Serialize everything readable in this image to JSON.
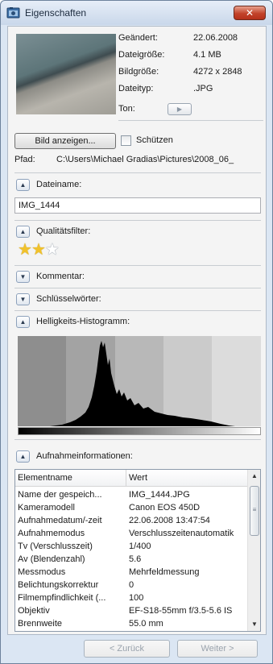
{
  "window": {
    "title": "Eigenschaften",
    "close_label": "✕"
  },
  "file_info": {
    "rows": [
      {
        "label": "Geändert:",
        "value": "22.06.2008"
      },
      {
        "label": "Dateigröße:",
        "value": "4.1 MB"
      },
      {
        "label": "Bildgröße:",
        "value": "4272 x 2848"
      },
      {
        "label": "Dateityp:",
        "value": ".JPG"
      }
    ],
    "sound_label": "Ton:"
  },
  "actions": {
    "view_image": "Bild anzeigen...",
    "protect": "Schützen"
  },
  "path": {
    "label": "Pfad:",
    "value": "C:\\Users\\Michael Gradias\\Pictures\\2008_06_"
  },
  "sections": {
    "filename": "Dateiname:",
    "quality": "Qualitätsfilter:",
    "comment": "Kommentar:",
    "keywords": "Schlüsselwörter:",
    "histogram": "Helligkeits-Histogramm:",
    "capture": "Aufnahmeinformationen:"
  },
  "filename_value": "IMG_1444",
  "rating": {
    "value": 2,
    "max": 3
  },
  "table": {
    "headers": [
      "Elementname",
      "Wert"
    ],
    "rows": [
      [
        "Name der gespeich...",
        "IMG_1444.JPG"
      ],
      [
        "Kameramodell",
        "Canon EOS 450D"
      ],
      [
        "Aufnahmedatum/-zeit",
        "22.06.2008 13:47:54"
      ],
      [
        "Aufnahmemodus",
        "Verschlusszeitenautomatik"
      ],
      [
        "Tv (Verschlusszeit)",
        "1/400"
      ],
      [
        "Av (Blendenzahl)",
        "5.6"
      ],
      [
        "Messmodus",
        "Mehrfeldmessung"
      ],
      [
        "Belichtungskorrektur",
        "0"
      ],
      [
        "Filmempfindlichkeit (...",
        "100"
      ],
      [
        "Objektiv",
        "EF-S18-55mm f/3.5-5.6 IS"
      ],
      [
        "Brennweite",
        "55.0 mm"
      ]
    ]
  },
  "footer": {
    "back": "< Zurück",
    "next": "Weiter >"
  },
  "colors": {
    "titlebar": "#c9d7ea",
    "close": "#c2432a",
    "star": "#f1c22b"
  }
}
